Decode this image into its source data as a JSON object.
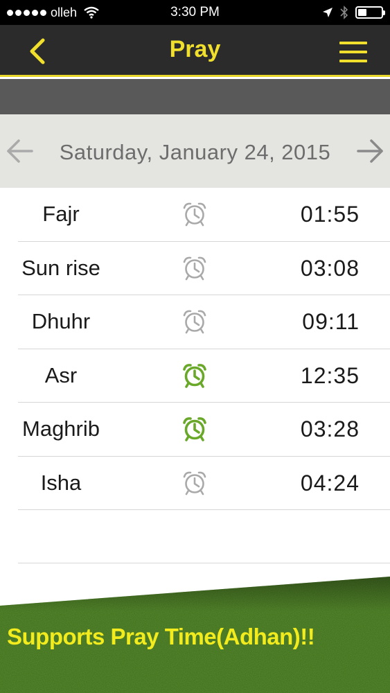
{
  "status_bar": {
    "carrier": "olleh",
    "time": "3:30 PM",
    "icons": [
      "signal-dots-icon",
      "wifi-icon",
      "location-arrow-icon",
      "bluetooth-icon",
      "battery-icon"
    ]
  },
  "nav": {
    "title": "Pray",
    "back_icon": "chevron-left-icon",
    "menu_icon": "hamburger-menu-icon",
    "accent_color": "#f1df2e"
  },
  "date_bar": {
    "date": "Saturday, January 24, 2015",
    "prev_icon": "arrow-left-icon",
    "next_icon": "arrow-right-icon"
  },
  "prayers": [
    {
      "name": "Fajr",
      "time": "01:55",
      "alarm_on": false
    },
    {
      "name": "Sun rise",
      "time": "03:08",
      "alarm_on": false
    },
    {
      "name": "Dhuhr",
      "time": "09:11",
      "alarm_on": false
    },
    {
      "name": "Asr",
      "time": "12:35",
      "alarm_on": true
    },
    {
      "name": "Maghrib",
      "time": "03:28",
      "alarm_on": true
    },
    {
      "name": "Isha",
      "time": "04:24",
      "alarm_on": false
    }
  ],
  "colors": {
    "alarm_on": "#6aa82a",
    "alarm_off": "#a9a9a9",
    "banner_green": "#3d6b1c",
    "banner_text": "#f2ec1e"
  },
  "banner": {
    "text": "Supports Pray Time(Adhan)!!"
  }
}
